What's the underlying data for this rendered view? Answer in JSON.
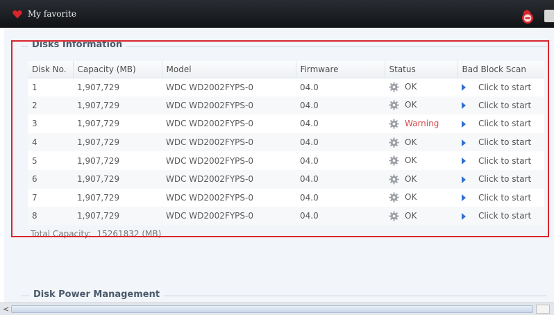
{
  "window": {
    "title": "My favorite"
  },
  "disks_info": {
    "legend": "Disks Information",
    "columns": [
      "Disk No.",
      "Capacity (MB)",
      "Model",
      "Firmware",
      "Status",
      "Bad Block Scan"
    ],
    "rows": [
      {
        "disk": "1",
        "capacity": "1,907,729",
        "model": "WDC WD2002FYPS-0",
        "firmware": "04.0",
        "status": "OK",
        "scan": "Click to start"
      },
      {
        "disk": "2",
        "capacity": "1,907,729",
        "model": "WDC WD2002FYPS-0",
        "firmware": "04.0",
        "status": "OK",
        "scan": "Click to start"
      },
      {
        "disk": "3",
        "capacity": "1,907,729",
        "model": "WDC WD2002FYPS-0",
        "firmware": "04.0",
        "status": "Warning",
        "scan": "Click to start"
      },
      {
        "disk": "4",
        "capacity": "1,907,729",
        "model": "WDC WD2002FYPS-0",
        "firmware": "04.0",
        "status": "OK",
        "scan": "Click to start"
      },
      {
        "disk": "5",
        "capacity": "1,907,729",
        "model": "WDC WD2002FYPS-0",
        "firmware": "04.0",
        "status": "OK",
        "scan": "Click to start"
      },
      {
        "disk": "6",
        "capacity": "1,907,729",
        "model": "WDC WD2002FYPS-0",
        "firmware": "04.0",
        "status": "OK",
        "scan": "Click to start"
      },
      {
        "disk": "7",
        "capacity": "1,907,729",
        "model": "WDC WD2002FYPS-0",
        "firmware": "04.0",
        "status": "OK",
        "scan": "Click to start"
      },
      {
        "disk": "8",
        "capacity": "1,907,729",
        "model": "WDC WD2002FYPS-0",
        "firmware": "04.0",
        "status": "OK",
        "scan": "Click to start"
      }
    ],
    "total_label": "Total Capacity:",
    "total_value": "15261832 (MB)"
  },
  "power": {
    "legend": "Disk Power Management"
  },
  "scrollbar": {
    "left_arrow": "<"
  },
  "icons": {
    "title": "heart-icon",
    "logout": "logout-icon",
    "status": "gear-icon",
    "scan": "play-icon"
  },
  "colors": {
    "highlight": "#d8262c",
    "warning": "#d2494d",
    "titlebar": "#1b1d21",
    "scan_arrow": "#2f6fd0"
  }
}
